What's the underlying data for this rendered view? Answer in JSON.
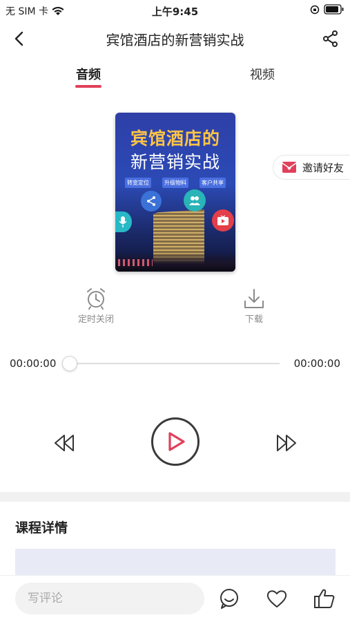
{
  "status_bar": {
    "carrier": "无 SIM 卡",
    "time": "上午9:45"
  },
  "nav": {
    "title": "宾馆酒店的新营销实战"
  },
  "tabs": [
    {
      "label": "音频",
      "active": true
    },
    {
      "label": "视频",
      "active": false
    }
  ],
  "cover": {
    "title_line1": "宾馆酒店的",
    "title_line2": "新营销实战",
    "tags": [
      "转变定位",
      "升级物料",
      "客户共享"
    ]
  },
  "invite": {
    "label": "邀请好友"
  },
  "tools": {
    "timer_label": "定时关闭",
    "download_label": "下载"
  },
  "player": {
    "current_time": "00:00:00",
    "total_time": "00:00:00",
    "progress": 0
  },
  "details": {
    "title": "课程详情"
  },
  "bottom_bar": {
    "comment_placeholder": "写评论"
  },
  "colors": {
    "accent": "#e0405a",
    "tab_underline": "#e0405a",
    "play_triangle": "#e0405a"
  },
  "icons": [
    "back-icon",
    "share-icon",
    "alarm-clock-icon",
    "download-icon",
    "rewind-icon",
    "play-icon",
    "fast-forward-icon",
    "comment-bubble-icon",
    "heart-icon",
    "thumbs-up-icon",
    "gift-envelope-icon",
    "wifi-icon",
    "battery-icon",
    "orientation-lock-icon"
  ]
}
